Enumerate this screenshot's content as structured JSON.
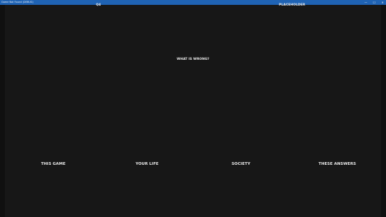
{
  "window": {
    "title": "Game Not Found (DEBUG)",
    "controls": {
      "minimize": "—",
      "maximize": "☐",
      "close": "✕"
    },
    "titlebar_color": "#1f63b4"
  },
  "hud": {
    "question_number": "Q4",
    "player_name": "PLACEHOLDER"
  },
  "question": {
    "text": "WHAT IS WRONG?"
  },
  "answers": [
    {
      "label": "THIS GAME"
    },
    {
      "label": "YOUR LIFE"
    },
    {
      "label": "SOCIETY"
    },
    {
      "label": "THESE ANSWERS"
    }
  ],
  "colors": {
    "background": "#171717",
    "text": "#ededed"
  }
}
